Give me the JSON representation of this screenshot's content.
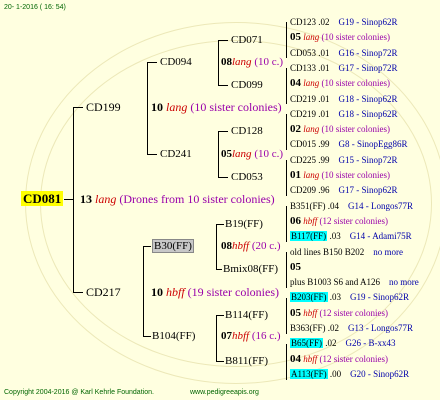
{
  "header": {
    "date": "20-  1-2016  ( 16: 54)"
  },
  "footer": {
    "copyright": "Copyright 2004-2016 @ Karl Kehrle Foundation.",
    "url": "www.pedigreeapis.org"
  },
  "root": {
    "id": "CD081",
    "num": "13",
    "lang": "lang",
    "note": "(Drones from 10 sister colonies)"
  },
  "sire": {
    "id": "CD199",
    "num": "10",
    "lang": "lang",
    "note": "(10 sister colonies)"
  },
  "dam": {
    "id": "CD217",
    "num": "10",
    "lang": "hbff",
    "note": "(19 sister colonies)"
  },
  "sire_sire": {
    "id": "CD094",
    "num": "08",
    "lang": "lang",
    "note": "(10 c.)"
  },
  "sire_dam": {
    "id": "CD241",
    "num": "05",
    "lang": "lang",
    "note": "(10 c.)"
  },
  "dam_sire": {
    "id": "B30(FF)",
    "num": "08",
    "lang": "hbff",
    "note": "(20 c.)"
  },
  "dam_dam": {
    "id": "B104(FF)",
    "num": "07",
    "lang": "hbff",
    "note": "(16 c.)"
  },
  "g3": [
    {
      "id": "CD071"
    },
    {
      "id": "CD099"
    },
    {
      "id": "CD128"
    },
    {
      "id": "CD053"
    },
    {
      "id": "B19(FF)"
    },
    {
      "id": "Bmix08(FF)"
    },
    {
      "id": "B114(FF)"
    },
    {
      "id": "B811(FF)"
    }
  ],
  "g4": [
    {
      "a": "CD123",
      "b": ".02",
      "c": "G19 - Sinop62R"
    },
    {
      "n": "05",
      "l": "lang",
      "t": "(10 sister colonies)"
    },
    {
      "a": "CD053",
      "b": ".01",
      "c": "G16 - Sinop72R"
    },
    {
      "a": "CD133",
      "b": ".01",
      "c": "G17 - Sinop72R"
    },
    {
      "n": "04",
      "l": "lang",
      "t": "(10 sister colonies)"
    },
    {
      "a": "CD219",
      "b": ".01",
      "c": "G18 - Sinop62R"
    },
    {
      "a": "CD219",
      "b": ".01",
      "c": "G18 - Sinop62R"
    },
    {
      "n": "02",
      "l": "lang",
      "t": "(10 sister colonies)"
    },
    {
      "a": "CD015",
      "b": ".99",
      "c": "G8 - SinopEgg86R"
    },
    {
      "a": "CD225",
      "b": ".99",
      "c": "G15 - Sinop72R"
    },
    {
      "n": "01",
      "l": "lang",
      "t": "(10 sister colonies)"
    },
    {
      "a": "CD209",
      "b": ".96",
      "c": "G17 - Sinop62R"
    },
    {
      "a": "B351(FF)",
      "b": ".04",
      "c": "G14 - Longos77R"
    },
    {
      "n": "06",
      "l": "hbff",
      "t": "(12 sister colonies)"
    },
    {
      "a": "B117(FF)",
      "b": ".03",
      "c": "G14 - Adami75R",
      "hl": true
    },
    {
      "lines": "old lines B150 B202",
      "more": "no more"
    },
    {
      "n": "05"
    },
    {
      "lines": "plus B1003 S6 and A126",
      "more": "no more"
    },
    {
      "a": "B203(FF)",
      "b": ".03",
      "c": "G19 - Sinop62R",
      "hl": true
    },
    {
      "n": "05",
      "l": "hbff",
      "t": "(12 sister colonies)"
    },
    {
      "a": "B363(FF)",
      "b": ".02",
      "c": "G13 - Longos77R"
    },
    {
      "a": "B65(FF)",
      "b": ".02",
      "c": "G26 - B-xx43",
      "hl": true
    },
    {
      "n": "04",
      "l": "hbff",
      "t": "(12 sister colonies)"
    },
    {
      "a": "A113(FF)",
      "b": ".00",
      "c": "G20 - Sinop62R",
      "hl": true
    }
  ]
}
